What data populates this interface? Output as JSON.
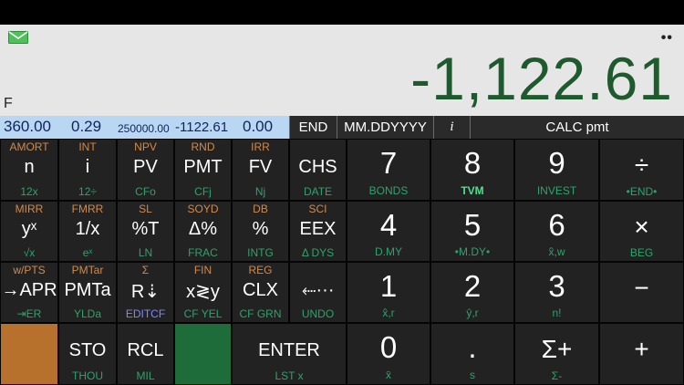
{
  "display": {
    "value": "-1,122.61",
    "flag": "F",
    "dots": "••"
  },
  "registers": {
    "n": "360.00",
    "i": "0.29",
    "pv": "250000.00",
    "pmt": "-1122.61",
    "fv": "0.00"
  },
  "status": {
    "end": "END",
    "date_format": "MM.DDYYYY",
    "italic_i": "i",
    "calc": "CALC pmt"
  },
  "keys": [
    {
      "top": "AMORT",
      "main": "n",
      "bot": "12x"
    },
    {
      "top": "INT",
      "main": "i",
      "bot": "12÷"
    },
    {
      "top": "NPV",
      "main": "PV",
      "bot": "CFo"
    },
    {
      "top": "RND",
      "main": "PMT",
      "bot": "CFj"
    },
    {
      "top": "IRR",
      "main": "FV",
      "bot": "Nj"
    },
    {
      "top": "",
      "main": "CHS",
      "bot": "DATE"
    },
    {
      "top": "",
      "main": "7",
      "bot": "BONDS"
    },
    {
      "top": "",
      "main": "8",
      "bot": "TVM"
    },
    {
      "top": "",
      "main": "9",
      "bot": "INVEST"
    },
    {
      "top": "",
      "main": "÷",
      "bot": "•END•"
    },
    {
      "top": "MIRR",
      "main": "yˣ",
      "bot": "√x"
    },
    {
      "top": "FMRR",
      "main": "1/x",
      "bot": "eˣ"
    },
    {
      "top": "SL",
      "main": "%T",
      "bot": "LN"
    },
    {
      "top": "SOYD",
      "main": "Δ%",
      "bot": "FRAC"
    },
    {
      "top": "DB",
      "main": "%",
      "bot": "INTG"
    },
    {
      "top": "SCI",
      "main": "EEX",
      "bot": "Δ DYS"
    },
    {
      "top": "",
      "main": "4",
      "bot": "D.MY"
    },
    {
      "top": "",
      "main": "5",
      "bot": "•M.DY•"
    },
    {
      "top": "",
      "main": "6",
      "bot": "x̂,w"
    },
    {
      "top": "",
      "main": "×",
      "bot": "BEG"
    },
    {
      "top": "w/PTS",
      "main": "→APR",
      "bot": "⇥ER"
    },
    {
      "top": "PMTar",
      "main": "PMTa",
      "bot": "YLDa"
    },
    {
      "top": "Σ",
      "main": "R⇣",
      "bot": "EDITCF"
    },
    {
      "top": "FIN",
      "main": "x≷y",
      "bot": "CF YEL"
    },
    {
      "top": "REG",
      "main": "CLX",
      "bot": "CF GRN"
    },
    {
      "top": "",
      "main": "⬸···",
      "bot": "UNDO"
    },
    {
      "top": "",
      "main": "1",
      "bot": "x̂,r"
    },
    {
      "top": "",
      "main": "2",
      "bot": "ŷ,r"
    },
    {
      "top": "",
      "main": "3",
      "bot": "n!"
    },
    {
      "top": "",
      "main": "−",
      "bot": ""
    },
    {
      "top": "",
      "main": "",
      "bot": ""
    },
    {
      "top": "",
      "main": "STO",
      "bot": "THOU"
    },
    {
      "top": "",
      "main": "RCL",
      "bot": "MIL"
    },
    {
      "top": "",
      "main": "",
      "bot": ""
    },
    {
      "top": "",
      "main": "ENTER",
      "bot": "LST x"
    },
    {
      "top": "",
      "main": "0",
      "bot": "x̄"
    },
    {
      "top": "",
      "main": ".",
      "bot": "s"
    },
    {
      "top": "",
      "main": "Σ+",
      "bot": "Σ-"
    },
    {
      "top": "",
      "main": "+",
      "bot": ""
    }
  ],
  "colors": {
    "display_bg": "#e6e6e6",
    "value_color": "#1e5a2d",
    "register_bg": "#b9d6f3",
    "key_bg": "#222222",
    "gold_label": "#d08a4c",
    "green_label": "#2fa26b",
    "orange_key": "#b8702d",
    "green_key": "#1f6c3b"
  },
  "icons": {
    "mail": "envelope-icon"
  }
}
